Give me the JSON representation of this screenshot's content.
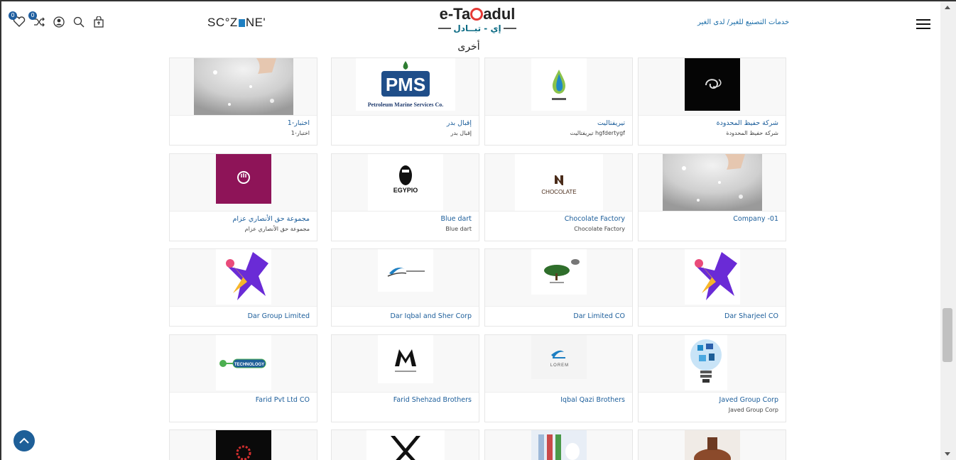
{
  "header": {
    "wishlist_count": "0",
    "compare_count": "0",
    "brand_sczone": "SC°Z",
    "brand_sczone_tail": "NE'",
    "logo_main_left": "e-Ta",
    "logo_main_right": "adul",
    "logo_sub": "إي - تبــادل",
    "services_link": "خدمات التصنيع للغير/ لدى الغير"
  },
  "section_title": "أخرى",
  "companies": [
    {
      "name": "شركة حفيظ المحدودة",
      "sub": "شركة حفيظ المحدودة",
      "logo": "black-swirl-logo"
    },
    {
      "name": "تيريفتاليت",
      "sub": "hgfdertygf تيريفتاليت",
      "logo": "water-drop-logo"
    },
    {
      "name": "إقبال بدر",
      "sub": "إقبال بدر",
      "logo": "pms-logo",
      "logo_text": "Petroleum Marine Services Co."
    },
    {
      "name": "اختبار-1",
      "sub": "اختبار-1",
      "logo": "salt-photo"
    },
    {
      "name": "Company -01",
      "sub": "",
      "logo": "salt-photo"
    },
    {
      "name": "Chocolate Factory",
      "sub": "Chocolate Factory",
      "logo": "chocolate-logo",
      "logo_text": "CHOCOLATE"
    },
    {
      "name": "Blue dart",
      "sub": "Blue dart",
      "logo": "egypio-logo",
      "logo_text": "EGYPIO"
    },
    {
      "name": "مجموعة حق الأنصاري عزام",
      "sub": "مجموعة حق الأنصاري عزام",
      "logo": "magenta-logo"
    },
    {
      "name": "Dar Sharjeel CO",
      "sub": "",
      "logo": "star-person-logo"
    },
    {
      "name": "Dar Limited CO",
      "sub": "",
      "logo": "tree-logo"
    },
    {
      "name": "Dar Iqbal and Sher Corp",
      "sub": "",
      "logo": "wave-logo"
    },
    {
      "name": "Dar Group Limited",
      "sub": "",
      "logo": "star-person-logo"
    },
    {
      "name": "Javed Group Corp",
      "sub": "Javed Group Corp",
      "logo": "bulb-logo"
    },
    {
      "name": "Iqbal Qazi Brothers",
      "sub": "",
      "logo": "lorem-logo",
      "logo_text": "LOREM"
    },
    {
      "name": "Farid Shehzad Brothers",
      "sub": "",
      "logo": "m-logo"
    },
    {
      "name": "Farid Pvt Ltd CO",
      "sub": "",
      "logo": "technology-logo",
      "logo_text": "TECHNOLOGY"
    },
    {
      "name": "",
      "sub": "",
      "logo": "pottery-photo"
    },
    {
      "name": "",
      "sub": "",
      "logo": "bottles-photo"
    },
    {
      "name": "",
      "sub": "",
      "logo": "x-logo"
    },
    {
      "name": "",
      "sub": "",
      "logo": "red-dot-logo"
    }
  ],
  "colors": {
    "accent": "#1e5f98",
    "link": "#1b5d9a",
    "logo_red": "#e53935",
    "logo_teal": "#0c6b84"
  }
}
